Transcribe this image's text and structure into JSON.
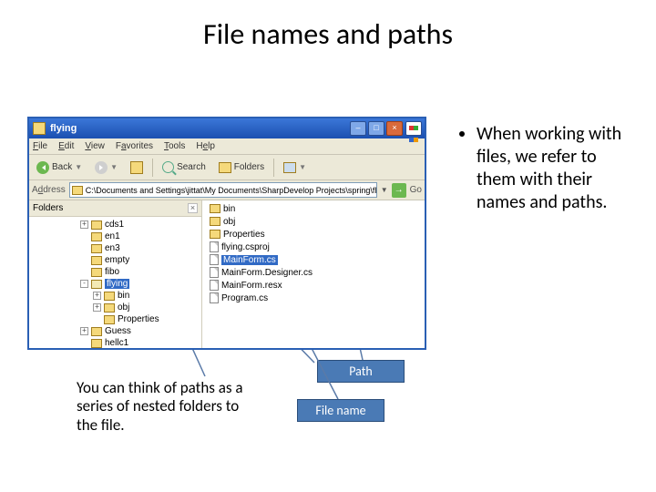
{
  "slide": {
    "title": "File names and paths",
    "bullet": "When working with files, we refer to them with their names and paths.",
    "caption": "You can think of paths as a series of nested folders to the file.",
    "label_path": "Path",
    "label_filename": "File name"
  },
  "explorer": {
    "title": "flying",
    "menu": {
      "file": "File",
      "edit": "Edit",
      "view": "View",
      "favorites": "Favorites",
      "tools": "Tools",
      "help": "Help"
    },
    "toolbar": {
      "back": "Back",
      "search": "Search",
      "folders": "Folders"
    },
    "address": {
      "label": "Address",
      "path": "C:\\Documents and Settings\\jittat\\My Documents\\SharpDevelop Projects\\spring\\flying",
      "go": "Go"
    },
    "folders_pane": {
      "title": "Folders",
      "tree": [
        {
          "indent": 1,
          "exp": "+",
          "label": "cds1"
        },
        {
          "indent": 1,
          "exp": "",
          "label": "en1"
        },
        {
          "indent": 1,
          "exp": "",
          "label": "en3"
        },
        {
          "indent": 1,
          "exp": "",
          "label": "empty"
        },
        {
          "indent": 1,
          "exp": "",
          "label": "fibo"
        },
        {
          "indent": 1,
          "exp": "-",
          "label": "flying",
          "open": true,
          "selected": true
        },
        {
          "indent": 2,
          "exp": "+",
          "label": "bin"
        },
        {
          "indent": 2,
          "exp": "+",
          "label": "obj"
        },
        {
          "indent": 2,
          "exp": "",
          "label": "Properties"
        },
        {
          "indent": 1,
          "exp": "+",
          "label": "Guess"
        },
        {
          "indent": 1,
          "exp": "",
          "label": "hellc1"
        }
      ]
    },
    "files": [
      {
        "type": "folder",
        "name": "bin"
      },
      {
        "type": "folder",
        "name": "obj"
      },
      {
        "type": "folder",
        "name": "Properties"
      },
      {
        "type": "file",
        "name": "flying.csproj"
      },
      {
        "type": "file",
        "name": "MainForm.cs",
        "selected": true
      },
      {
        "type": "file",
        "name": "MainForm.Designer.cs"
      },
      {
        "type": "file",
        "name": "MainForm.resx"
      },
      {
        "type": "file",
        "name": "Program.cs"
      }
    ]
  }
}
